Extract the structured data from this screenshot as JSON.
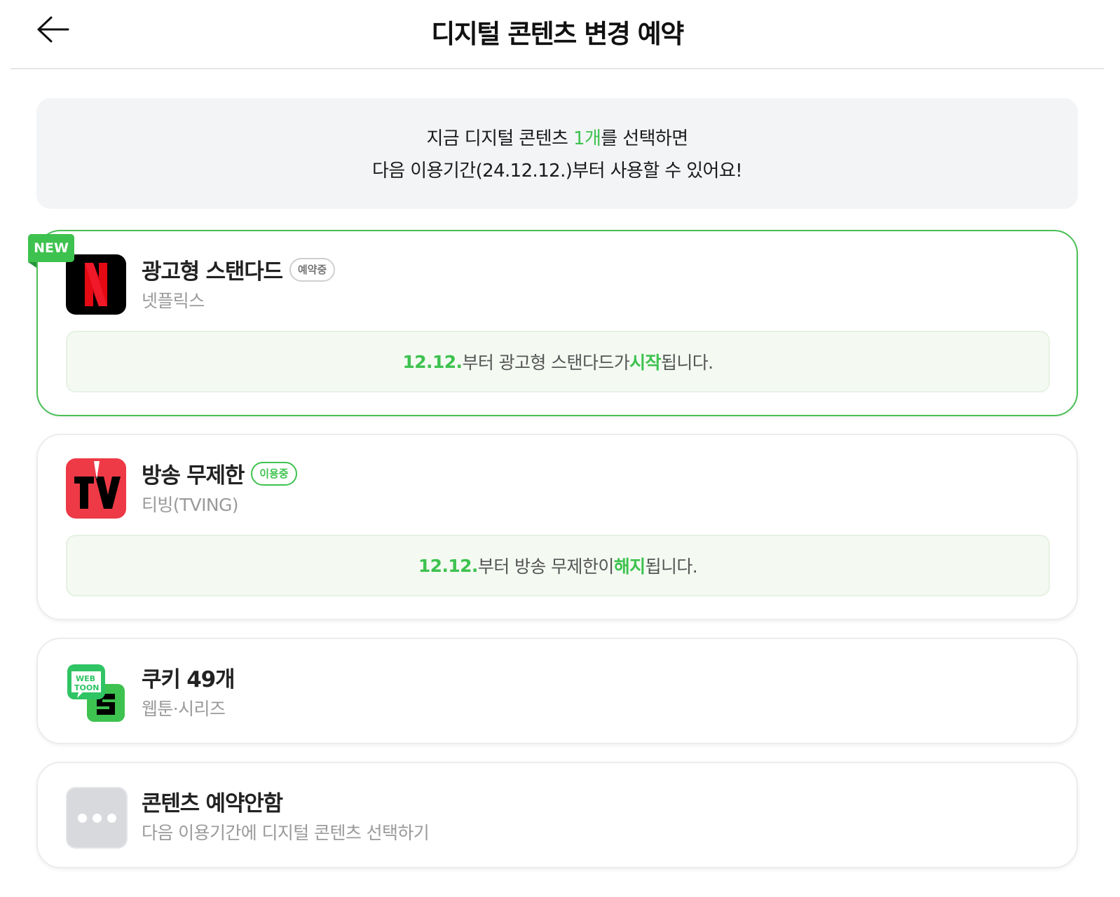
{
  "header": {
    "title": "디지털 콘텐츠 변경 예약",
    "back_icon": "arrow-left-icon"
  },
  "notice": {
    "line1_prefix": "지금 디지털 콘텐츠 ",
    "line1_highlight": "1개",
    "line1_suffix": "를 선택하면",
    "line2": "다음 이용기간(24.12.12.)부터 사용할 수 있어요!"
  },
  "cards": [
    {
      "name": "광고형 스탠다드",
      "badge": "예약중",
      "provider": "넷플릭스",
      "ribbon": "NEW",
      "logo_icon": "netflix-logo-icon",
      "status": {
        "date": "12.12.",
        "middle": "부터 광고형 스탠다드가 ",
        "highlight": "시작",
        "suffix": "됩니다."
      }
    },
    {
      "name": "방송 무제한",
      "badge": "이용중",
      "provider": "티빙(TVING)",
      "logo_icon": "tving-logo-icon",
      "status": {
        "date": "12.12.",
        "middle": "부터 방송 무제한이 ",
        "highlight": "해지",
        "suffix": "됩니다."
      }
    },
    {
      "name": "쿠키 49개",
      "provider": "웹툰·시리즈",
      "logo_icon": "webtoon-series-logo-icon",
      "logo_text_1": "WEB",
      "logo_text_2": "TOON"
    },
    {
      "name": "콘텐츠 예약안함",
      "provider": "다음 이용기간에 디지털 콘텐츠 선택하기",
      "logo_icon": "more-dots-icon"
    }
  ],
  "colors": {
    "accent": "#3ec24f",
    "netflix_red": "#e50914",
    "tving_red": "#ee3a46"
  }
}
